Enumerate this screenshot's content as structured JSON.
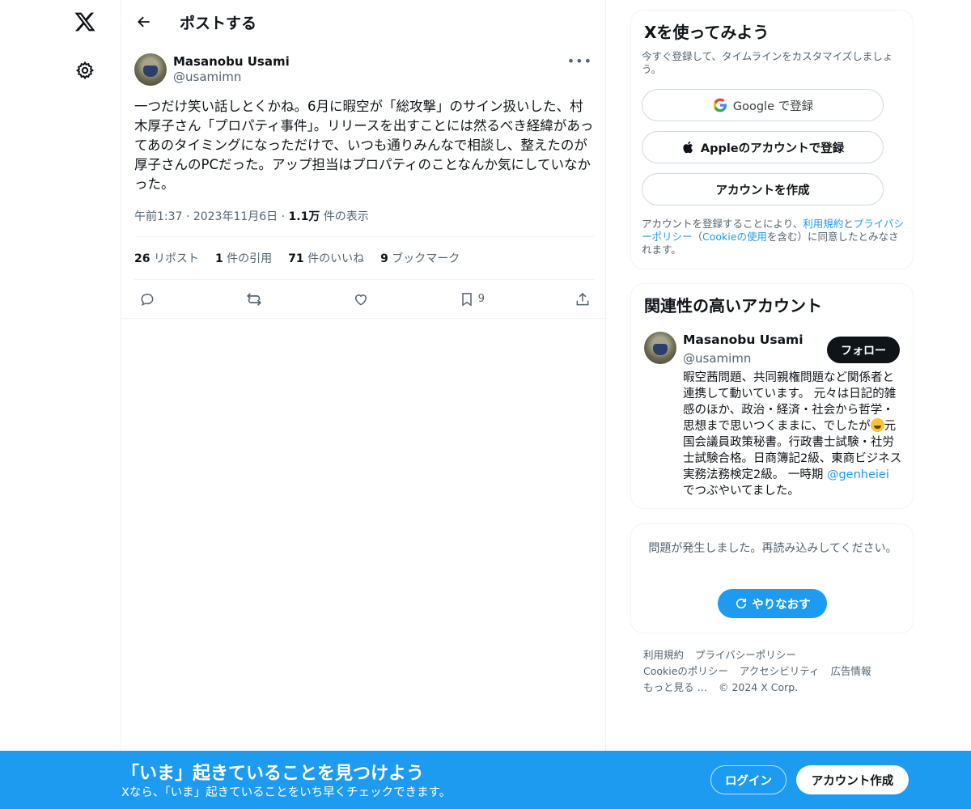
{
  "nav": {
    "logo_icon": "x-logo-icon",
    "settings_icon": "gear-icon"
  },
  "header": {
    "back_icon": "arrow-left-icon",
    "title": "ポストする"
  },
  "tweet": {
    "author_name": "Masanobu Usami",
    "author_handle": "@usamimn",
    "more_label": "•••",
    "text": "一つだけ笑い話しとくかね。6月に暇空が「総攻撃」のサイン扱いした、村木厚子さん「プロパティ事件」。リリースを出すことには然るべき経緯があってあのタイミングになっただけで、いつも通りみんなで相談し、整えたのが厚子さんのPCだった。アップ担当はプロパティのことなんか気にしていなかった。",
    "time": "午前1:37",
    "date": "2023年11月6日",
    "views_count": "1.1万",
    "views_label": "件の表示",
    "stats": [
      {
        "count": "26",
        "label": "リポスト"
      },
      {
        "count": "1",
        "label": "件の引用"
      },
      {
        "count": "71",
        "label": "件のいいね"
      },
      {
        "count": "9",
        "label": "ブックマーク"
      }
    ],
    "bookmark_count": "9"
  },
  "signup_card": {
    "title": "Xを使ってみよう",
    "subtitle": "今すぐ登録して、タイムラインをカスタマイズしましょう。",
    "google_g": "G",
    "google_label": "Google で登録",
    "apple_label": "Appleのアカウントで登録",
    "create_label": "アカウントを作成",
    "legal_pre": "アカウントを登録することにより、",
    "legal_terms": "利用規約",
    "legal_and": "と",
    "legal_privacy": "プライバシーポリシー",
    "legal_mid": "（",
    "legal_cookie": "Cookieの使用",
    "legal_post": "を含む）に同意したとみなされます。"
  },
  "related_card": {
    "title": "関連性の高いアカウント",
    "name": "Masanobu Usami",
    "handle": "@usamimn",
    "follow_label": "フォロー",
    "bio_part1": "暇空茜問題、共同親権問題など関係者と連携して動いています。 元々は日記的雑感のほか、政治・経済・社会から哲学・思想まで思いつくままに、でしたが",
    "bio_part2": "元国会議員政策秘書。行政書士試験・社労士試験合格。日商簿記2級、東商ビジネス実務法務検定2級。 一時期",
    "bio_mention": "@genheiei",
    "bio_part3": " でつぶやいてました。"
  },
  "error_card": {
    "message": "問題が発生しました。再読み込みしてください。",
    "retry_label": "やりなおす"
  },
  "footer": {
    "links": [
      "利用規約",
      "プライバシーポリシー",
      "Cookieのポリシー",
      "アクセシビリティ",
      "広告情報",
      "もっと見る …"
    ],
    "copyright": "© 2024 X Corp."
  },
  "bottom_bar": {
    "title": "「いま」起きていることを見つけよう",
    "subtitle": "Xなら、「いま」起きていることをいち早くチェックできます。",
    "login_label": "ログイン",
    "signup_label": "アカウント作成",
    "color": "#1d9bf0"
  }
}
